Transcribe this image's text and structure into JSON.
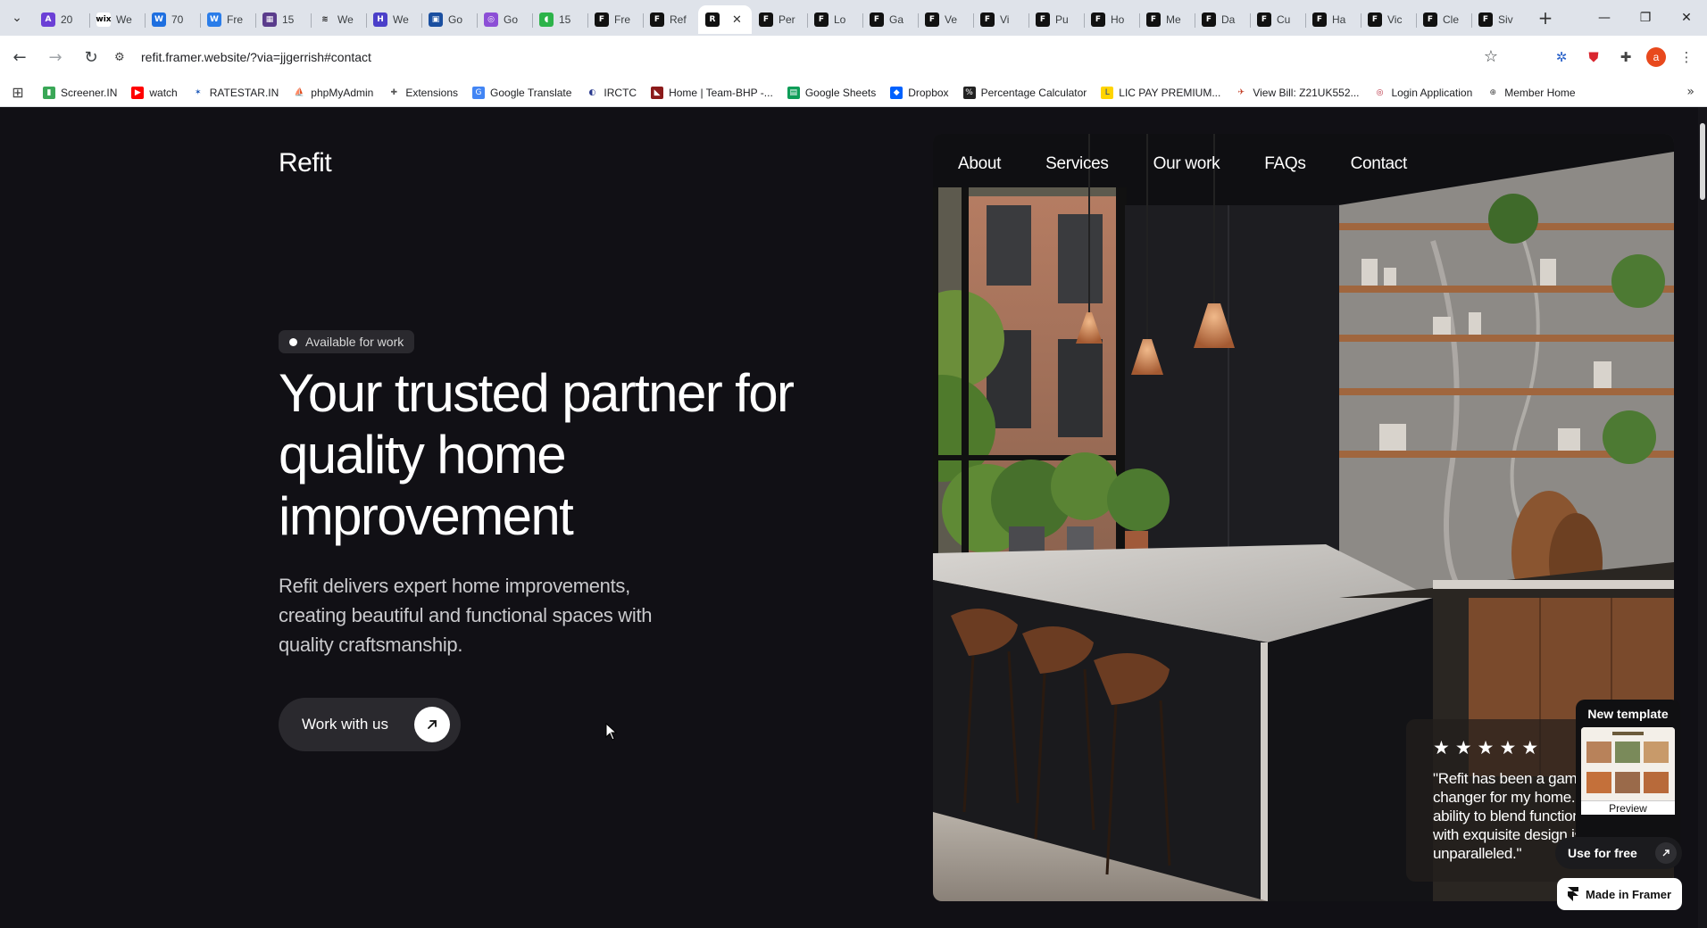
{
  "browser": {
    "tabs": [
      {
        "title": "20",
        "color": "#6b3fd6",
        "glyph": "A"
      },
      {
        "title": "We",
        "color": "#ffffff",
        "glyph": "wix",
        "glyph_color": "#000000"
      },
      {
        "title": "70",
        "color": "#1e6fe0",
        "glyph": "W"
      },
      {
        "title": "Fre",
        "color": "#2b7de9",
        "glyph": "W"
      },
      {
        "title": "15",
        "color": "#5a3c8c",
        "glyph": "▦"
      },
      {
        "title": "We",
        "color": "#dfe3ea",
        "glyph": "≋",
        "glyph_color": "#222222"
      },
      {
        "title": "We",
        "color": "#4b3fc9",
        "glyph": "H"
      },
      {
        "title": "Go",
        "color": "#1a4fa0",
        "glyph": "▣"
      },
      {
        "title": "Go",
        "color": "#8c4fd6",
        "glyph": "◎"
      },
      {
        "title": "15",
        "color": "#2db34a",
        "glyph": "◖"
      },
      {
        "title": "Fre",
        "color": "#111111",
        "glyph": "F"
      },
      {
        "title": "Ref",
        "color": "#111111",
        "glyph": "F"
      },
      {
        "title": "",
        "color": "#111111",
        "glyph": "R",
        "active": true
      },
      {
        "title": "Per",
        "color": "#111111",
        "glyph": "F"
      },
      {
        "title": "Lo",
        "color": "#111111",
        "glyph": "F"
      },
      {
        "title": "Ga",
        "color": "#111111",
        "glyph": "F"
      },
      {
        "title": "Ve",
        "color": "#111111",
        "glyph": "F"
      },
      {
        "title": "Vi",
        "color": "#111111",
        "glyph": "F"
      },
      {
        "title": "Pu",
        "color": "#111111",
        "glyph": "F"
      },
      {
        "title": "Ho",
        "color": "#111111",
        "glyph": "F"
      },
      {
        "title": "Me",
        "color": "#111111",
        "glyph": "F"
      },
      {
        "title": "Da",
        "color": "#111111",
        "glyph": "F"
      },
      {
        "title": "Cu",
        "color": "#111111",
        "glyph": "F"
      },
      {
        "title": "Ha",
        "color": "#111111",
        "glyph": "F"
      },
      {
        "title": "Vic",
        "color": "#111111",
        "glyph": "F"
      },
      {
        "title": "Cle",
        "color": "#111111",
        "glyph": "F"
      },
      {
        "title": "Siv",
        "color": "#111111",
        "glyph": "F"
      }
    ],
    "url": "refit.framer.website/?via=jjgerrish#contact",
    "profile_initial": "a",
    "bookmarks": [
      {
        "label": "Screener.IN",
        "color": "#3aa757",
        "glyph": "▮"
      },
      {
        "label": "watch",
        "color": "#ff0000",
        "glyph": "▶"
      },
      {
        "label": "RATESTAR.IN",
        "color": "#ffffff",
        "glyph": "✶",
        "glyph_color": "#1a56b8"
      },
      {
        "label": "phpMyAdmin",
        "color": "#ffffff",
        "glyph": "⛵",
        "glyph_color": "#e77b1c"
      },
      {
        "label": "Extensions",
        "color": "#ffffff",
        "glyph": "✚",
        "glyph_color": "#555555"
      },
      {
        "label": "Google Translate",
        "color": "#4285f4",
        "glyph": "G"
      },
      {
        "label": "IRCTC",
        "color": "#ffffff",
        "glyph": "◐",
        "glyph_color": "#2a3b8f"
      },
      {
        "label": "Home | Team-BHP -...",
        "color": "#8b1a1a",
        "glyph": "◣"
      },
      {
        "label": "Google Sheets",
        "color": "#0f9d58",
        "glyph": "▤"
      },
      {
        "label": "Dropbox",
        "color": "#0061fe",
        "glyph": "◆"
      },
      {
        "label": "Percentage Calculator",
        "color": "#222222",
        "glyph": "%"
      },
      {
        "label": "LIC PAY PREMIUM...",
        "color": "#ffd400",
        "glyph": "L",
        "glyph_color": "#1a3a8f"
      },
      {
        "label": "View Bill: Z21UK552...",
        "color": "#ffffff",
        "glyph": "✈",
        "glyph_color": "#c23b22"
      },
      {
        "label": "Login Application",
        "color": "#ffffff",
        "glyph": "◎",
        "glyph_color": "#b5283a"
      },
      {
        "label": "Member Home",
        "color": "#ffffff",
        "glyph": "⊕",
        "glyph_color": "#444444"
      }
    ]
  },
  "page": {
    "logo": "Refit",
    "nav": [
      "About",
      "Services",
      "Our work",
      "FAQs",
      "Contact"
    ],
    "badge": "Available for work",
    "headline": "Your trusted partner for quality home improvement",
    "subtext": "Refit delivers expert home improvements, creating beautiful and functional spaces with quality craftsmanship.",
    "cta_label": "Work with us",
    "testimonial": {
      "stars": [
        "★",
        "★",
        "★",
        "★",
        "★"
      ],
      "lines": [
        "\"Refit has been a game",
        "changer for my home. Their",
        "ability to blend function",
        "with exquisite design is",
        "unparalleled.\""
      ]
    },
    "template_promo": {
      "title": "New template",
      "preview_label": "Preview",
      "use_label": "Use for free",
      "made_in": "Made in Framer"
    }
  },
  "colors": {
    "page_bg": "#111015",
    "chip_bg": "#2a292e"
  }
}
